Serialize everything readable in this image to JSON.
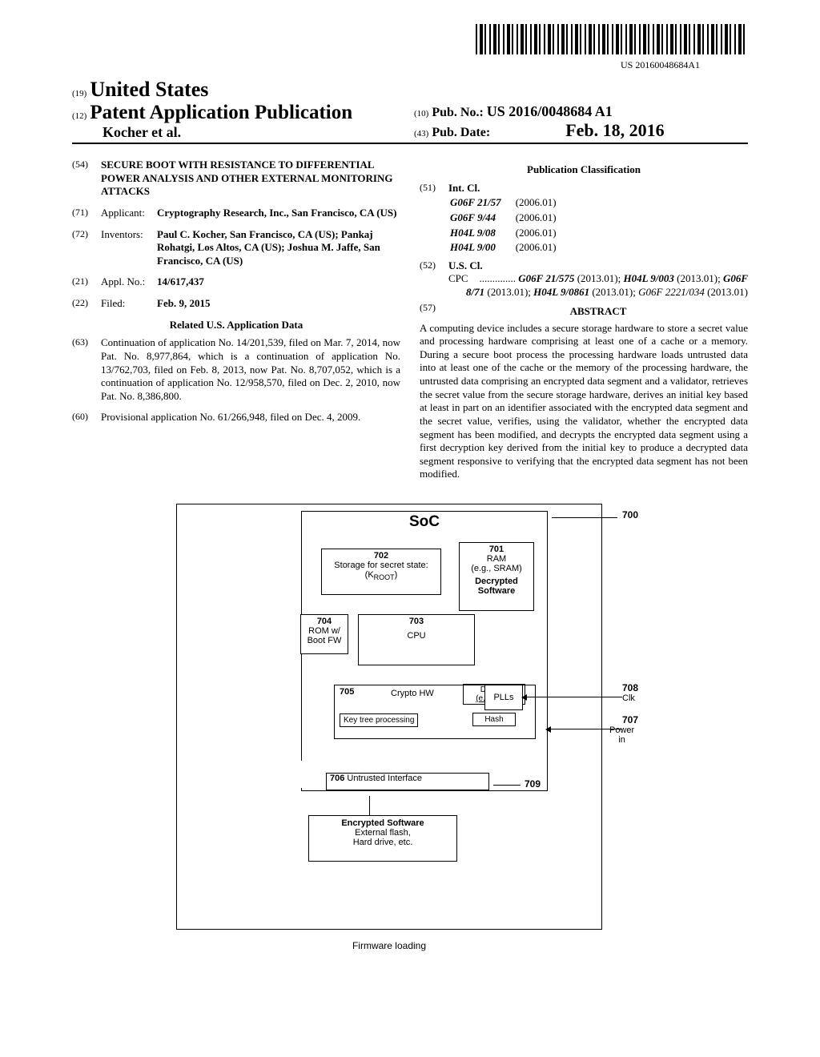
{
  "barcode_number": "US 20160048684A1",
  "header": {
    "country_code": "(19)",
    "country": "United States",
    "doc_kind_code": "(12)",
    "doc_kind": "Patent Application Publication",
    "authors": "Kocher et al.",
    "pub_no_code": "(10)",
    "pub_no_label": "Pub. No.:",
    "pub_no": "US 2016/0048684 A1",
    "pub_date_code": "(43)",
    "pub_date_label": "Pub. Date:",
    "pub_date": "Feb. 18, 2016"
  },
  "title": {
    "code": "(54)",
    "text": "SECURE BOOT WITH RESISTANCE TO DIFFERENTIAL POWER ANALYSIS AND OTHER EXTERNAL MONITORING ATTACKS"
  },
  "applicant": {
    "code": "(71)",
    "label": "Applicant:",
    "text": "Cryptography Research, Inc., San Francisco, CA (US)"
  },
  "inventors": {
    "code": "(72)",
    "label": "Inventors:",
    "text": "Paul C. Kocher, San Francisco, CA (US); Pankaj Rohatgi, Los Altos, CA (US); Joshua M. Jaffe, San Francisco, CA (US)"
  },
  "appl_no": {
    "code": "(21)",
    "label": "Appl. No.:",
    "value": "14/617,437"
  },
  "filed": {
    "code": "(22)",
    "label": "Filed:",
    "value": "Feb. 9, 2015"
  },
  "related_data_title": "Related U.S. Application Data",
  "continuation": {
    "code": "(63)",
    "text": "Continuation of application No. 14/201,539, filed on Mar. 7, 2014, now Pat. No. 8,977,864, which is a continuation of application No. 13/762,703, filed on Feb. 8, 2013, now Pat. No. 8,707,052, which is a continuation of application No. 12/958,570, filed on Dec. 2, 2010, now Pat. No. 8,386,800."
  },
  "provisional": {
    "code": "(60)",
    "text": "Provisional application No. 61/266,948, filed on Dec. 4, 2009."
  },
  "classification_title": "Publication Classification",
  "int_cl": {
    "code": "(51)",
    "label": "Int. Cl.",
    "rows": [
      {
        "c": "G06F 21/57",
        "d": "(2006.01)"
      },
      {
        "c": "G06F 9/44",
        "d": "(2006.01)"
      },
      {
        "c": "H04L 9/08",
        "d": "(2006.01)"
      },
      {
        "c": "H04L 9/00",
        "d": "(2006.01)"
      }
    ]
  },
  "us_cl": {
    "code": "(52)",
    "label": "U.S. Cl.",
    "cpc_prefix": "CPC",
    "cpc_text": "G06F 21/575 (2013.01); H04L 9/003 (2013.01); G06F 8/71 (2013.01); H04L 9/0861 (2013.01); G06F 2221/034 (2013.01)"
  },
  "abstract": {
    "code": "(57)",
    "label": "ABSTRACT",
    "text": "A computing device includes a secure storage hardware to store a secret value and processing hardware comprising at least one of a cache or a memory. During a secure boot process the processing hardware loads untrusted data into at least one of the cache or the memory of the processing hardware, the untrusted data comprising an encrypted data segment and a validator, retrieves the secret value from the secure storage hardware, derives an initial key based at least in part on an identifier associated with the encrypted data segment and the secret value, verifies, using the validator, whether the encrypted data segment has been modified, and decrypts the encrypted data segment using a first decryption key derived from the initial key to produce a decrypted data segment responsive to verifying that the encrypted data segment has not been modified."
  },
  "figure": {
    "soc": "SoC",
    "ref_700": "700",
    "box_702_num": "702",
    "box_702_line1": "Storage for secret state:",
    "box_702_line2": "(K",
    "box_702_sub": "ROOT",
    "box_702_line2_end": ")",
    "box_701_num": "701",
    "box_701_line1": "RAM",
    "box_701_line2": "(e.g., SRAM)",
    "box_701_line3": "Decrypted",
    "box_701_line4": "Software",
    "box_703_num": "703",
    "box_703_label": "CPU",
    "box_704_num": "704",
    "box_704_line1": "ROM w/",
    "box_704_line2": "Boot FW",
    "box_705_num": "705",
    "box_705_label": "Crypto HW",
    "box_705_sub1": "Key tree processing",
    "box_705_dec_label": "Decrypt",
    "box_705_dec_sub": "(e.g. AES)",
    "box_705_hash": "Hash",
    "plls": "PLLs",
    "ref_708": "708",
    "clk": "Clk",
    "ref_707": "707",
    "power_in": "Power in",
    "box_706_num": "706",
    "box_706_label": "Untrusted Interface",
    "ref_709": "709",
    "ext_title": "Encrypted Software",
    "ext_line1": "External flash,",
    "ext_line2": "Hard drive, etc.",
    "caption": "Firmware loading"
  }
}
